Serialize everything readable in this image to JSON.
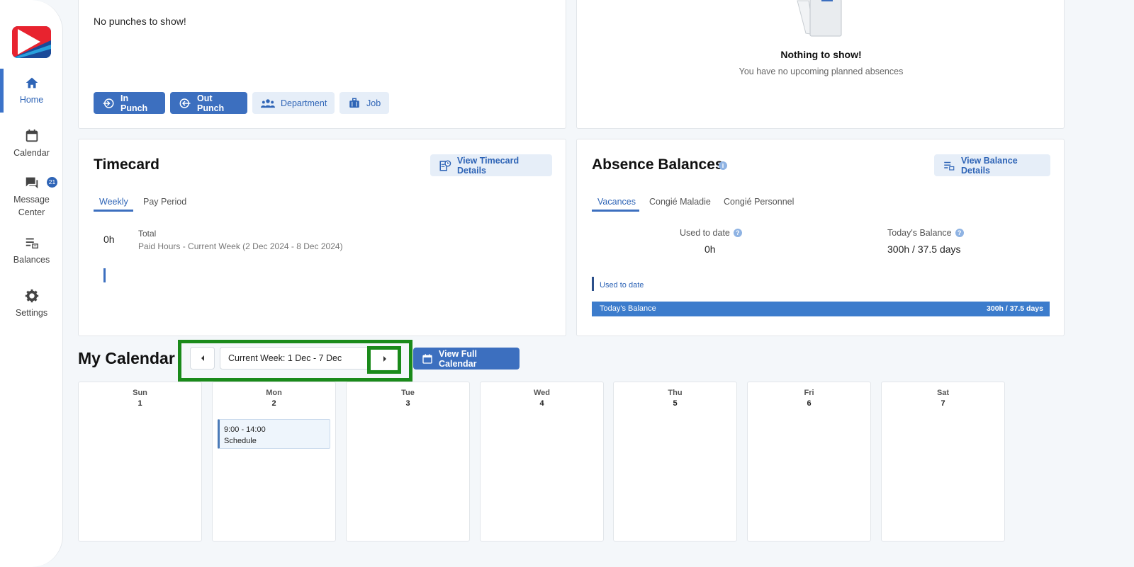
{
  "sidebar": {
    "items": [
      {
        "label": "Home",
        "icon": "home-icon"
      },
      {
        "label": "Calendar",
        "icon": "calendar-icon"
      },
      {
        "label": "Message Center",
        "icon": "message-icon"
      },
      {
        "label": "Balances",
        "icon": "balances-icon"
      },
      {
        "label": "Settings",
        "icon": "gear-icon"
      }
    ],
    "message_badge": "21",
    "active": "Home"
  },
  "punch_card": {
    "empty_text": "No punches to show!",
    "buttons": {
      "in_punch": "In Punch",
      "out_punch": "Out Punch",
      "department": "Department",
      "job": "Job"
    }
  },
  "absences_card": {
    "empty_title": "Nothing to show!",
    "empty_subtitle": "You have no upcoming planned absences"
  },
  "timecard": {
    "title": "Timecard",
    "details_button": "View Timecard Details",
    "tabs": [
      "Weekly",
      "Pay Period"
    ],
    "active_tab": "Weekly",
    "hours": "0h",
    "total_label": "Total",
    "paid_hours_label": "Paid Hours - Current Week (2 Dec 2024 - 8 Dec 2024)"
  },
  "absence_balances": {
    "title": "Absence Balances",
    "details_button": "View Balance Details",
    "tabs": [
      "Vacances",
      "Congié Maladie",
      "Congié Personnel"
    ],
    "active_tab": "Vacances",
    "used_label": "Used to date",
    "used_value": "0h",
    "balance_label": "Today's Balance",
    "balance_value": "300h / 37.5 days",
    "bar_used_label": "Used to date",
    "bar_balance_label": "Today's Balance",
    "bar_balance_value": "300h / 37.5 days",
    "balance_fraction": 1.0
  },
  "my_calendar": {
    "title": "My Calendar",
    "week_label": "Current Week: 1 Dec - 7 Dec",
    "full_calendar_button": "View Full Calendar",
    "days": [
      {
        "name": "Sun",
        "date": "1"
      },
      {
        "name": "Mon",
        "date": "2",
        "event": {
          "time": "9:00 - 14:00",
          "label": "Schedule"
        }
      },
      {
        "name": "Tue",
        "date": "3"
      },
      {
        "name": "Wed",
        "date": "4"
      },
      {
        "name": "Thu",
        "date": "5"
      },
      {
        "name": "Fri",
        "date": "6"
      },
      {
        "name": "Sat",
        "date": "7"
      }
    ]
  },
  "colors": {
    "accent": "#3c6fbf",
    "highlight": "#1a8a1a"
  }
}
